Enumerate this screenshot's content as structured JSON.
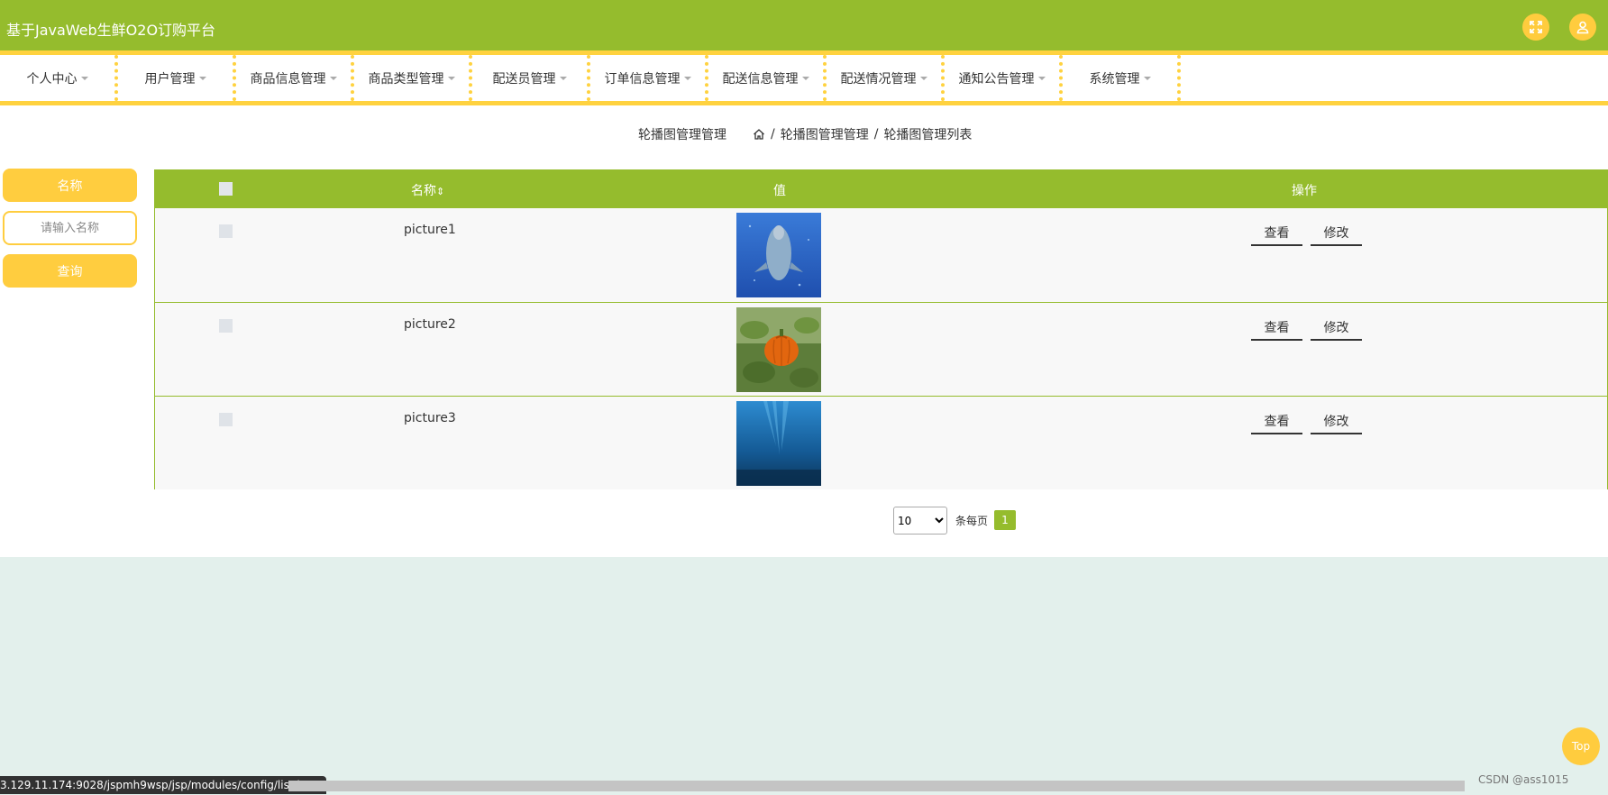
{
  "app": {
    "title": "基于JavaWeb生鲜O2O订购平台"
  },
  "header": {
    "fullscreen_icon": "expand-icon",
    "user_icon": "user-icon"
  },
  "nav": {
    "items": [
      {
        "label": "个人中心"
      },
      {
        "label": "用户管理"
      },
      {
        "label": "商品信息管理"
      },
      {
        "label": "商品类型管理"
      },
      {
        "label": "配送员管理"
      },
      {
        "label": "订单信息管理"
      },
      {
        "label": "配送信息管理"
      },
      {
        "label": "配送情况管理"
      },
      {
        "label": "通知公告管理"
      },
      {
        "label": "系统管理"
      }
    ]
  },
  "page": {
    "title": "轮播图管理管理",
    "breadcrumb": {
      "level1": "轮播图管理管理",
      "level2": "轮播图管理列表",
      "separator": "/"
    }
  },
  "search": {
    "label": "名称",
    "placeholder": "请输入名称",
    "value": "",
    "button": "查询"
  },
  "table": {
    "columns": {
      "name": "名称",
      "sort_mark": "⇕",
      "value": "值",
      "actions": "操作"
    },
    "rows": [
      {
        "name": "picture1",
        "image": "dolphin underwater photo",
        "view": "查看",
        "edit": "修改"
      },
      {
        "name": "picture2",
        "image": "orange pumpkin photo",
        "view": "查看",
        "edit": "修改"
      },
      {
        "name": "picture3",
        "image": "deep blue ocean photo",
        "view": "查看",
        "edit": "修改"
      }
    ]
  },
  "pagination": {
    "page_size": "10",
    "page_size_options": [
      "10"
    ],
    "per_page_text": "条每页",
    "current_page": "1"
  },
  "top_button": "Top",
  "status_url": "3.129.11.174:9028/jspmh9wsp/jsp/modules/config/list.jsp#",
  "watermark": "CSDN @ass1015",
  "colors": {
    "primary": "#95bc2d",
    "accent": "#ffcd3f",
    "page_bg": "#e3f0ec"
  }
}
